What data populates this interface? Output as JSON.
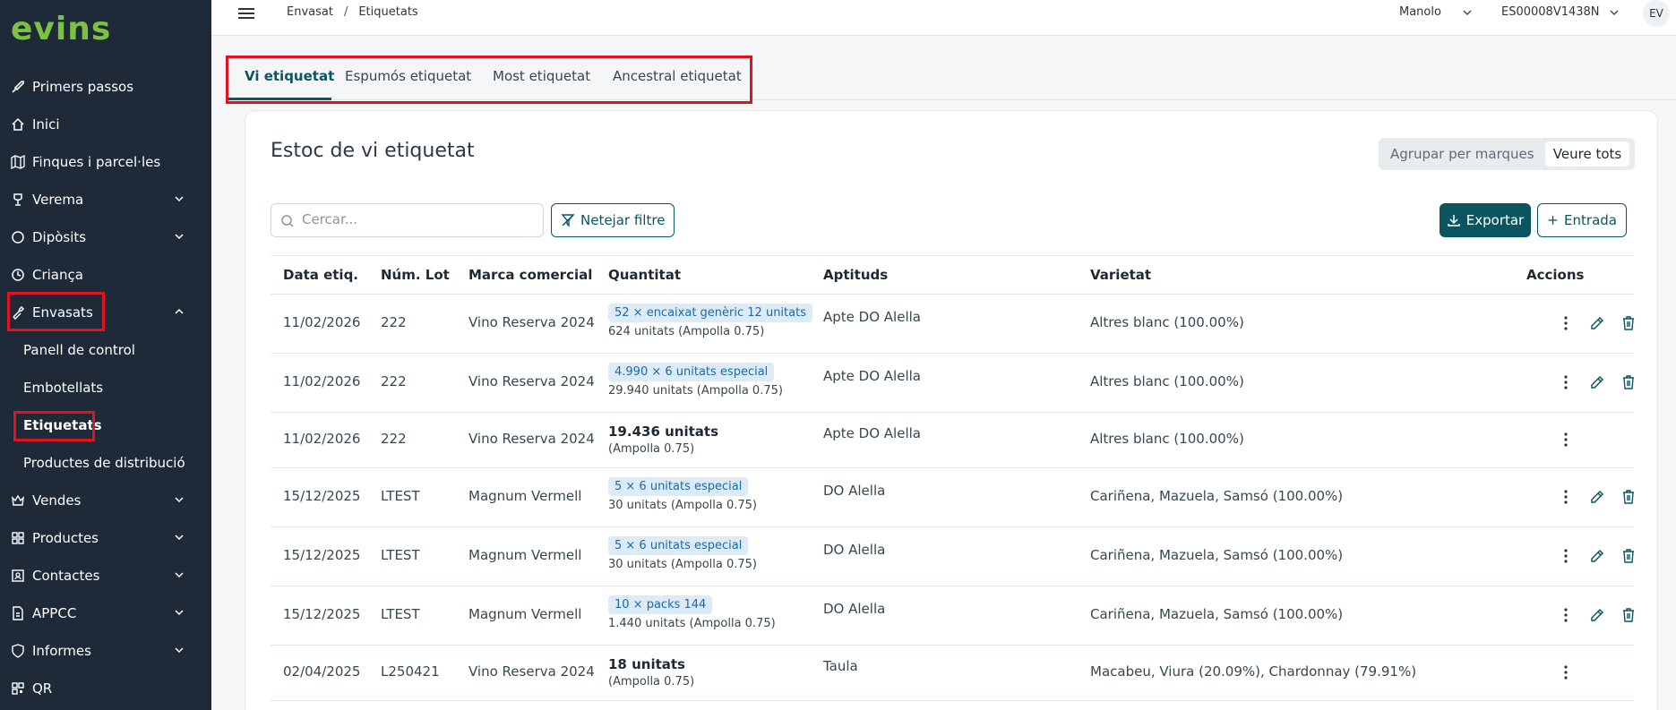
{
  "app": {
    "logo": "evins"
  },
  "colors": {
    "accent": "#0b5560",
    "sidebar_bg": "#1e2a38",
    "logo": "#7cc242",
    "badge_bg": "#dcebf7",
    "badge_text": "#1c6aa3",
    "highlight": "#e0141e"
  },
  "sidebar": {
    "items": [
      {
        "label": "Primers passos",
        "icon": "rocket-icon"
      },
      {
        "label": "Inici",
        "icon": "home-icon"
      },
      {
        "label": "Finques i parcel·les",
        "icon": "map-icon"
      },
      {
        "label": "Verema",
        "icon": "trophy-icon",
        "expandable": true
      },
      {
        "label": "Dipòsits",
        "icon": "circle-icon",
        "expandable": true
      },
      {
        "label": "Criança",
        "icon": "clock-icon"
      },
      {
        "label": "Envasats",
        "icon": "bottle-icon",
        "expandable": true,
        "expanded": true
      },
      {
        "label": "Vendes",
        "icon": "crown-icon",
        "expandable": true
      },
      {
        "label": "Productes",
        "icon": "grid-icon",
        "expandable": true
      },
      {
        "label": "Contactes",
        "icon": "contacts-icon",
        "expandable": true
      },
      {
        "label": "APPCC",
        "icon": "document-icon",
        "expandable": true
      },
      {
        "label": "Informes",
        "icon": "shield-icon",
        "expandable": true
      },
      {
        "label": "QR",
        "icon": "qr-icon"
      }
    ],
    "subitems": [
      {
        "label": "Panell de control"
      },
      {
        "label": "Embotellats"
      },
      {
        "label": "Etiquetats",
        "active": true
      },
      {
        "label": "Productes de distribució"
      }
    ]
  },
  "topbar": {
    "breadcrumb": [
      "Envasat",
      "Etiquetats"
    ],
    "breadcrumb_sep": "/",
    "user": "Manolo",
    "code": "ES00008V1438N",
    "avatar": "EV"
  },
  "tabs": [
    {
      "label": "Vi etiquetat",
      "active": true
    },
    {
      "label": "Espumós etiquetat"
    },
    {
      "label": "Most etiquetat"
    },
    {
      "label": "Ancestral etiquetat"
    }
  ],
  "main": {
    "title": "Estoc de vi etiquetat",
    "toggle": {
      "option1": "Agrupar per marques",
      "option2": "Veure tots",
      "selected": "Veure tots"
    },
    "search_placeholder": "Cercar...",
    "clear_filter": "Netejar filtre",
    "export": "Exportar",
    "entry": "Entrada"
  },
  "table": {
    "headers": [
      "Data etiq.",
      "Núm. Lot",
      "Marca comercial",
      "Quantitat",
      "Aptituds",
      "Varietat",
      "Accions"
    ],
    "rows": [
      {
        "date": "11/02/2026",
        "lot": "222",
        "brand": "Vino Reserva 2024",
        "qty_badge": "52 × encaixat genèric 12 unitats",
        "qty_sub": "624 unitats (Ampolla 0.75)",
        "aptitude": "Apte DO Alella",
        "variety": "Altres blanc (100.00%)",
        "edit": true
      },
      {
        "date": "11/02/2026",
        "lot": "222",
        "brand": "Vino Reserva 2024",
        "qty_badge": "4.990 × 6 unitats especial",
        "qty_sub": "29.940 unitats (Ampolla 0.75)",
        "aptitude": "Apte DO Alella",
        "variety": "Altres blanc (100.00%)",
        "edit": true
      },
      {
        "date": "11/02/2026",
        "lot": "222",
        "brand": "Vino Reserva 2024",
        "qty_main": "19.436 unitats",
        "qty_sub": "(Ampolla 0.75)",
        "aptitude": "Apte DO Alella",
        "variety": "Altres blanc (100.00%)",
        "edit": false
      },
      {
        "date": "15/12/2025",
        "lot": "LTEST",
        "brand": "Magnum Vermell",
        "qty_badge": "5 × 6 unitats especial",
        "qty_sub": "30 unitats (Ampolla 0.75)",
        "aptitude": "DO Alella",
        "variety": "Cariñena, Mazuela, Samsó (100.00%)",
        "edit": true
      },
      {
        "date": "15/12/2025",
        "lot": "LTEST",
        "brand": "Magnum Vermell",
        "qty_badge": "5 × 6 unitats especial",
        "qty_sub": "30 unitats (Ampolla 0.75)",
        "aptitude": "DO Alella",
        "variety": "Cariñena, Mazuela, Samsó (100.00%)",
        "edit": true
      },
      {
        "date": "15/12/2025",
        "lot": "LTEST",
        "brand": "Magnum Vermell",
        "qty_badge": "10 × packs 144",
        "qty_sub": "1.440 unitats (Ampolla 0.75)",
        "aptitude": "DO Alella",
        "variety": "Cariñena, Mazuela, Samsó (100.00%)",
        "edit": true
      },
      {
        "date": "02/04/2025",
        "lot": "L250421",
        "brand": "Vino Reserva 2024",
        "qty_main": "18 unitats",
        "qty_sub": "(Ampolla 0.75)",
        "aptitude": "Taula",
        "variety": "Macabeu, Viura (20.09%), Chardonnay (79.91%)",
        "edit": false
      }
    ]
  }
}
